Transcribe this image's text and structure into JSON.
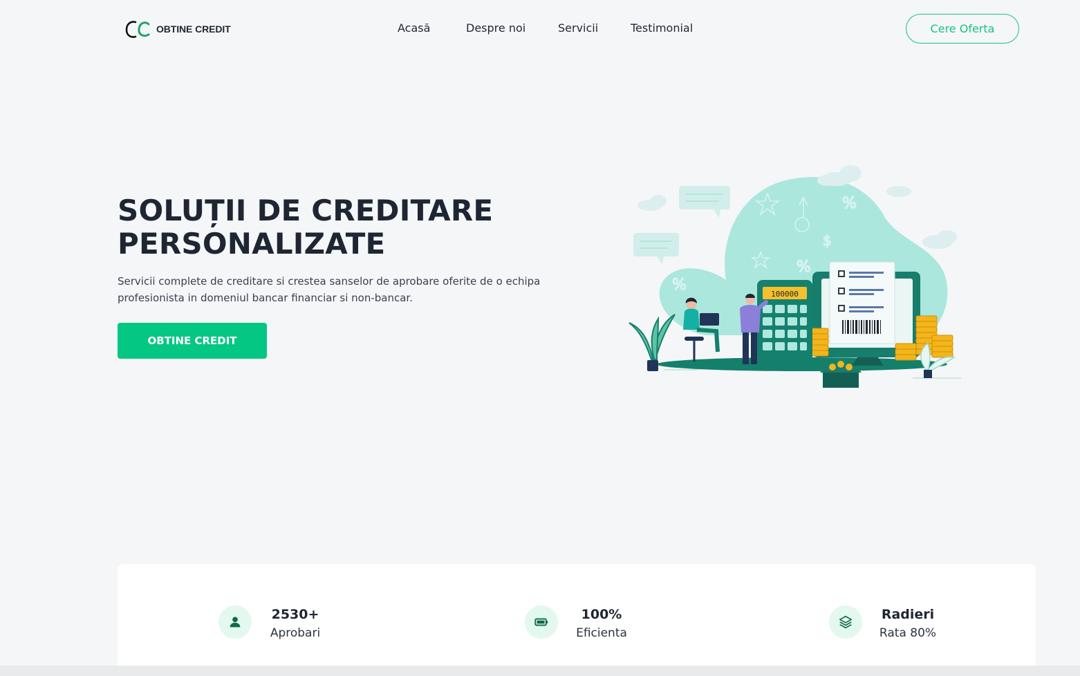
{
  "colors": {
    "accent": "#04c783",
    "accent_outline": "#17c383",
    "text_dark": "#1f2633",
    "background": "#f5f6f8",
    "stat_icon_bg": "#e3f8ee",
    "icon_green": "#0f6b47"
  },
  "header": {
    "logo_text": "OBTINE CREDIT",
    "logo_icon": "oc-monogram-icon",
    "nav": [
      "Acasă",
      "Despre noi",
      "Servicii",
      "Testimonial"
    ],
    "cta_label": "Cere Oferta"
  },
  "hero": {
    "title_line1": "SOLUȚII DE CREDITARE",
    "title_line2": "PERSONALIZATE",
    "subtitle": "Servicii complete de creditare si crestea sanselor de aprobare oferite de o echipa profesionista in domeniul bancar financiar si non-bancar.",
    "button_label": "OBTINE CREDIT",
    "calculator_display": "100000"
  },
  "stats": [
    {
      "icon": "user-icon",
      "value": "2530+",
      "label": "Aprobari"
    },
    {
      "icon": "battery-icon",
      "value": "100%",
      "label": "Eficienta"
    },
    {
      "icon": "layers-icon",
      "value": "Radieri",
      "label": "Rata 80%"
    }
  ]
}
